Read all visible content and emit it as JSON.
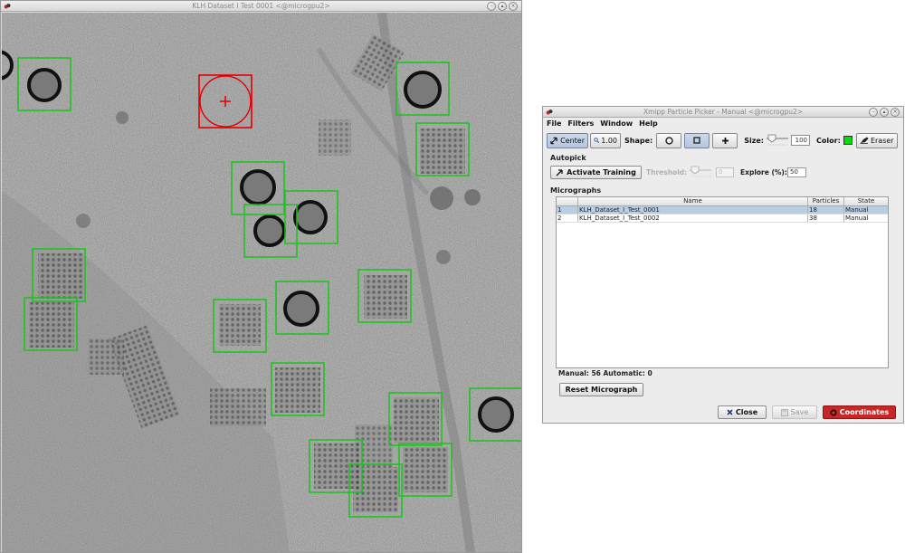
{
  "micrograph_window": {
    "title": "KLH Dataset I Test 0001 <@microgpu2>",
    "selected_particle": {
      "shape": "circle-in-square",
      "color": "#e00000"
    },
    "particle_box_color": "#19c419"
  },
  "picker_window": {
    "title": "Xmipp Particle Picker - Manual <@microgpu2>",
    "menu": [
      "File",
      "Filters",
      "Window",
      "Help"
    ],
    "toolbar": {
      "center_label": "Center",
      "zoom_value": "1.00",
      "shape_label": "Shape:",
      "size_label": "Size:",
      "size_value": "100",
      "color_label": "Color:",
      "color_value": "#00e000",
      "eraser_label": "Eraser"
    },
    "autopick": {
      "title": "Autopick",
      "activate_label": "Activate Training",
      "threshold_label": "Threshold:",
      "threshold_value": "0",
      "explore_label": "Explore (%):",
      "explore_value": "50"
    },
    "micrographs": {
      "title": "Micrographs",
      "columns": [
        "",
        "Name",
        "Particles",
        "State"
      ],
      "rows": [
        {
          "index": "1",
          "name": "KLH_Dataset_I_Test_0001",
          "particles": "18",
          "state": "Manual",
          "selected": true
        },
        {
          "index": "2",
          "name": "KLH_Dataset_I_Test_0002",
          "particles": "38",
          "state": "Manual",
          "selected": false
        }
      ]
    },
    "stats": "Manual: 56 Automatic: 0",
    "reset_label": "Reset Micrograph",
    "close_label": "Close",
    "save_label": "Save",
    "coordinates_label": "Coordinates"
  }
}
